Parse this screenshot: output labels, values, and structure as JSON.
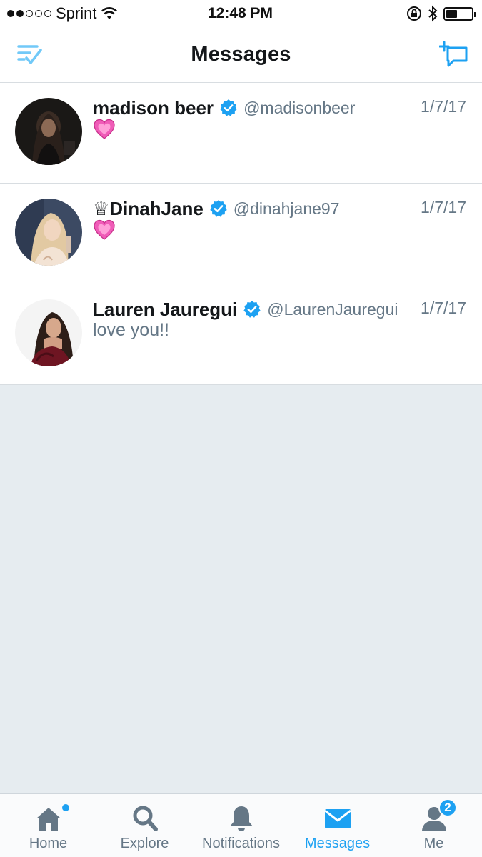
{
  "status_bar": {
    "carrier": "Sprint",
    "time": "12:48 PM",
    "battery_level": 0.45
  },
  "header": {
    "title": "Messages",
    "left_icon": "filter-check-icon",
    "right_icon": "new-message-icon"
  },
  "conversations": [
    {
      "name": "madison beer",
      "handle": "@madisonbeer",
      "date": "1/7/17",
      "preview": "",
      "preview_emoji": "heart-emoji",
      "verified": true
    },
    {
      "name": "♕DinahJane",
      "handle": "@dinahjane97",
      "date": "1/7/17",
      "preview": "",
      "preview_emoji": "heart-emoji",
      "verified": true
    },
    {
      "name": "Lauren Jauregui",
      "handle": "@LaurenJauregui",
      "date": "1/7/17",
      "preview": "love you!!",
      "verified": true
    }
  ],
  "tab_bar": {
    "tabs": [
      {
        "label": "Home",
        "icon": "home-icon",
        "active": false
      },
      {
        "label": "Explore",
        "icon": "search-icon",
        "active": false
      },
      {
        "label": "Notifications",
        "icon": "bell-icon",
        "active": false
      },
      {
        "label": "Messages",
        "icon": "envelope-icon",
        "active": true
      },
      {
        "label": "Me",
        "icon": "person-icon",
        "active": false,
        "badge": "2"
      }
    ]
  },
  "colors": {
    "accent": "#1da1f2",
    "text_primary": "#14171a",
    "text_secondary": "#657786",
    "background": "#e6ecf0"
  }
}
